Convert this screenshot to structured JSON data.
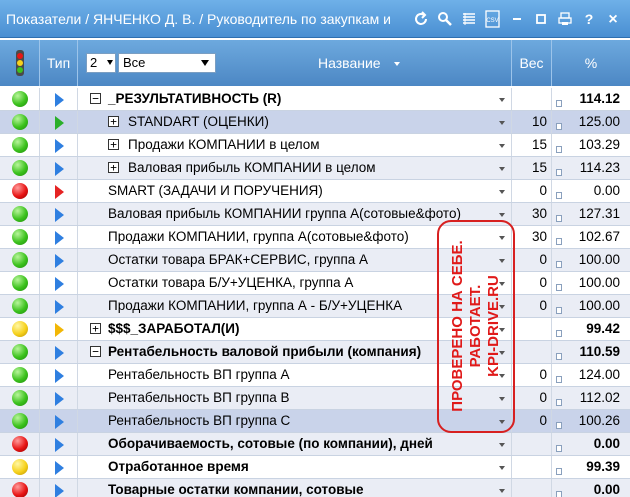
{
  "window": {
    "title": "Показатели / ЯНЧЕНКО Д. В. / Руководитель по закупкам и"
  },
  "toolbar_icons": [
    "refresh-icon",
    "search-icon",
    "list-icon",
    "csv-icon",
    "minimize-icon",
    "maximize-icon",
    "print-icon",
    "help-icon",
    "close-icon"
  ],
  "toolbar_labels": {
    "csv": "CSV",
    "help": "?",
    "close": "×"
  },
  "header": {
    "type_label": "Тип",
    "level_value": "2",
    "filter_value": "Все",
    "name_label": "Название",
    "weight_label": "Вес",
    "percent_label": "%"
  },
  "rows": [
    {
      "light": "green",
      "type": "blue",
      "expander": "−",
      "name": "_РЕЗУЛЬТАТИВНОСТЬ (R)",
      "bold": true,
      "weight": "",
      "percent": "114.12"
    },
    {
      "light": "green",
      "type": "green",
      "expander": "+",
      "name": "STANDART (ОЦЕНКИ)",
      "bold": false,
      "weight": "10",
      "percent": "125.00"
    },
    {
      "light": "green",
      "type": "blue",
      "expander": "+",
      "name": "Продажи КОМПАНИИ в целом",
      "bold": false,
      "weight": "15",
      "percent": "103.29"
    },
    {
      "light": "green",
      "type": "blue",
      "expander": "+",
      "name": "Валовая прибыль КОМПАНИИ в целом",
      "bold": false,
      "weight": "15",
      "percent": "114.23"
    },
    {
      "light": "red",
      "type": "red",
      "expander": "",
      "name": "SMART (ЗАДАЧИ И ПОРУЧЕНИЯ)",
      "bold": false,
      "weight": "0",
      "percent": "0.00"
    },
    {
      "light": "green",
      "type": "blue",
      "expander": "",
      "name": "Валовая прибыль КОМПАНИИ группа А(сотовые&фото)",
      "bold": false,
      "weight": "30",
      "percent": "127.31"
    },
    {
      "light": "green",
      "type": "blue",
      "expander": "",
      "name": "Продажи КОМПАНИИ, группа А(сотовые&фото)",
      "bold": false,
      "weight": "30",
      "percent": "102.67"
    },
    {
      "light": "green",
      "type": "blue",
      "expander": "",
      "name": "Остатки товара БРАК+СЕРВИС, группа А",
      "bold": false,
      "weight": "0",
      "percent": "100.00"
    },
    {
      "light": "green",
      "type": "blue",
      "expander": "",
      "name": "Остатки товара Б/У+УЦЕНКА, группа А",
      "bold": false,
      "weight": "0",
      "percent": "100.00"
    },
    {
      "light": "green",
      "type": "blue",
      "expander": "",
      "name": "Продажи КОМПАНИИ, группа А - Б/У+УЦЕНКА",
      "bold": false,
      "weight": "0",
      "percent": "100.00"
    },
    {
      "light": "yellow",
      "type": "yellow",
      "expander": "+",
      "name": "$$$_ЗАРАБОТАЛ(И)",
      "bold": true,
      "weight": "",
      "percent": "99.42"
    },
    {
      "light": "green",
      "type": "blue",
      "expander": "−",
      "name": "Рентабельность валовой прибыли (компания)",
      "bold": true,
      "weight": "",
      "percent": "110.59"
    },
    {
      "light": "green",
      "type": "blue",
      "expander": "",
      "name": "Рентабельность ВП группа А",
      "bold": false,
      "weight": "0",
      "percent": "124.00"
    },
    {
      "light": "green",
      "type": "blue",
      "expander": "",
      "name": "Рентабельность ВП группа В",
      "bold": false,
      "weight": "0",
      "percent": "112.02"
    },
    {
      "light": "green",
      "type": "blue",
      "expander": "",
      "name": "Рентабельность ВП группа С",
      "bold": false,
      "weight": "0",
      "percent": "100.26"
    },
    {
      "light": "red",
      "type": "blue",
      "expander": "",
      "name": "Оборачиваемость, сотовые (по компании), дней",
      "bold": true,
      "weight": "",
      "percent": "0.00"
    },
    {
      "light": "yellow",
      "type": "blue",
      "expander": "",
      "name": "Отработанное время",
      "bold": true,
      "weight": "",
      "percent": "99.39"
    },
    {
      "light": "red",
      "type": "blue",
      "expander": "",
      "name": "Товарные остатки компании, сотовые",
      "bold": true,
      "weight": "",
      "percent": "0.00"
    }
  ],
  "annotation": {
    "line1": "ПРОВЕРЕНО НА СЕБЕ.",
    "line2": "РАБОТАЕТ.",
    "line3": "KPI-DRIVE.RU"
  },
  "colors": {
    "titlebar": "#4a8fd2",
    "header": "#5a96d0",
    "annotation": "#e01a1a",
    "light_green": "#3cc21d",
    "light_red": "#e81515",
    "light_yellow": "#f6d11c"
  }
}
